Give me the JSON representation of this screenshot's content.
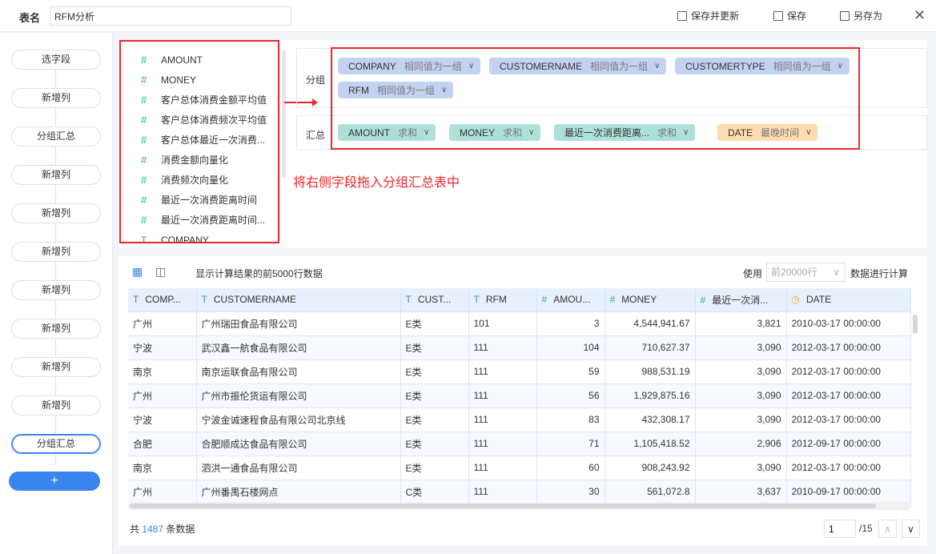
{
  "header": {
    "name_label": "表名",
    "name_value": "RFM分析",
    "save_update": "保存并更新",
    "save": "保存",
    "save_as": "另存为"
  },
  "sidebar": {
    "steps": [
      "选字段",
      "新增列",
      "分组汇总",
      "新增列",
      "新增列",
      "新增列",
      "新增列",
      "新增列",
      "新增列",
      "新增列",
      "分组汇总"
    ],
    "add": "+"
  },
  "fields": [
    {
      "type": "#",
      "name": "AMOUNT"
    },
    {
      "type": "#",
      "name": "MONEY"
    },
    {
      "type": "#",
      "name": "客户总体消费金额平均值"
    },
    {
      "type": "#",
      "name": "客户总体消费频次平均值"
    },
    {
      "type": "#",
      "name": "客户总体最近一次消费..."
    },
    {
      "type": "#",
      "name": "消费金额向量化"
    },
    {
      "type": "#",
      "name": "消费频次向量化"
    },
    {
      "type": "#",
      "name": "最近一次消费距离时间"
    },
    {
      "type": "#",
      "name": "最近一次消费距离时间..."
    },
    {
      "type": "T",
      "name": "COMPANY"
    }
  ],
  "hint": "将右侧字段拖入分组汇总表中",
  "group": {
    "label": "分组",
    "pills": [
      {
        "name": "COMPANY",
        "op": "相同值为一组"
      },
      {
        "name": "CUSTOMERNAME",
        "op": "相同值为一组"
      },
      {
        "name": "CUSTOMERTYPE",
        "op": "相同值为一组"
      },
      {
        "name": "RFM",
        "op": "相同值为一组"
      }
    ]
  },
  "summary": {
    "label": "汇总",
    "pills": [
      {
        "name": "AMOUNT",
        "op": "求和"
      },
      {
        "name": "MONEY",
        "op": "求和"
      },
      {
        "name": "最近一次消费距离...",
        "op": "求和"
      },
      {
        "name": "DATE",
        "op": "最晚时间"
      }
    ]
  },
  "preview": {
    "info": "显示计算结果的前5000行数据",
    "use": "使用",
    "rows_select": "前20000行",
    "calc": "数据进行计算"
  },
  "table": {
    "columns": [
      {
        "icon": "T",
        "name": "COMP..."
      },
      {
        "icon": "T",
        "name": "CUSTOMERNAME"
      },
      {
        "icon": "T",
        "name": "CUST..."
      },
      {
        "icon": "T",
        "name": "RFM"
      },
      {
        "icon": "#",
        "name": "AMOU..."
      },
      {
        "icon": "#",
        "name": "MONEY"
      },
      {
        "icon": "#",
        "name": "最近一次消..."
      },
      {
        "icon": "clock",
        "name": "DATE"
      }
    ],
    "rows": [
      [
        "广州",
        "广州瑞田食品有限公司",
        "E类",
        "101",
        "3",
        "4,544,941.67",
        "3,821",
        "2010-03-17 00:00:00"
      ],
      [
        "宁波",
        "武汉鑫一航食品有限公司",
        "E类",
        "111",
        "104",
        "710,627.37",
        "3,090",
        "2012-03-17 00:00:00"
      ],
      [
        "南京",
        "南京运联食品有限公司",
        "E类",
        "111",
        "59",
        "988,531.19",
        "3,090",
        "2012-03-17 00:00:00"
      ],
      [
        "广州",
        "广州市振伦货运有限公司",
        "E类",
        "111",
        "56",
        "1,929,875.16",
        "3,090",
        "2012-03-17 00:00:00"
      ],
      [
        "宁波",
        "宁波金诚速程食品有限公司北京线",
        "E类",
        "111",
        "83",
        "432,308.17",
        "3,090",
        "2012-03-17 00:00:00"
      ],
      [
        "合肥",
        "合肥顺成达食品有限公司",
        "E类",
        "111",
        "71",
        "1,105,418.52",
        "2,906",
        "2012-09-17 00:00:00"
      ],
      [
        "南京",
        "泗洪一通食品有限公司",
        "E类",
        "111",
        "60",
        "908,243.92",
        "3,090",
        "2012-03-17 00:00:00"
      ],
      [
        "广州",
        "广州番禺石楼网点",
        "C类",
        "111",
        "30",
        "561,072.8",
        "3,637",
        "2010-09-17 00:00:00"
      ]
    ]
  },
  "footer": {
    "prefix": "共",
    "count": "1487",
    "suffix": "条数据",
    "page": "1",
    "total": "/15"
  },
  "colors": {
    "accent": "#3a85f0",
    "highlight": "#f0252b",
    "group_pill": "#c4d2f2",
    "sum_pill": "#aee0da",
    "date_pill": "#fddcb0"
  }
}
